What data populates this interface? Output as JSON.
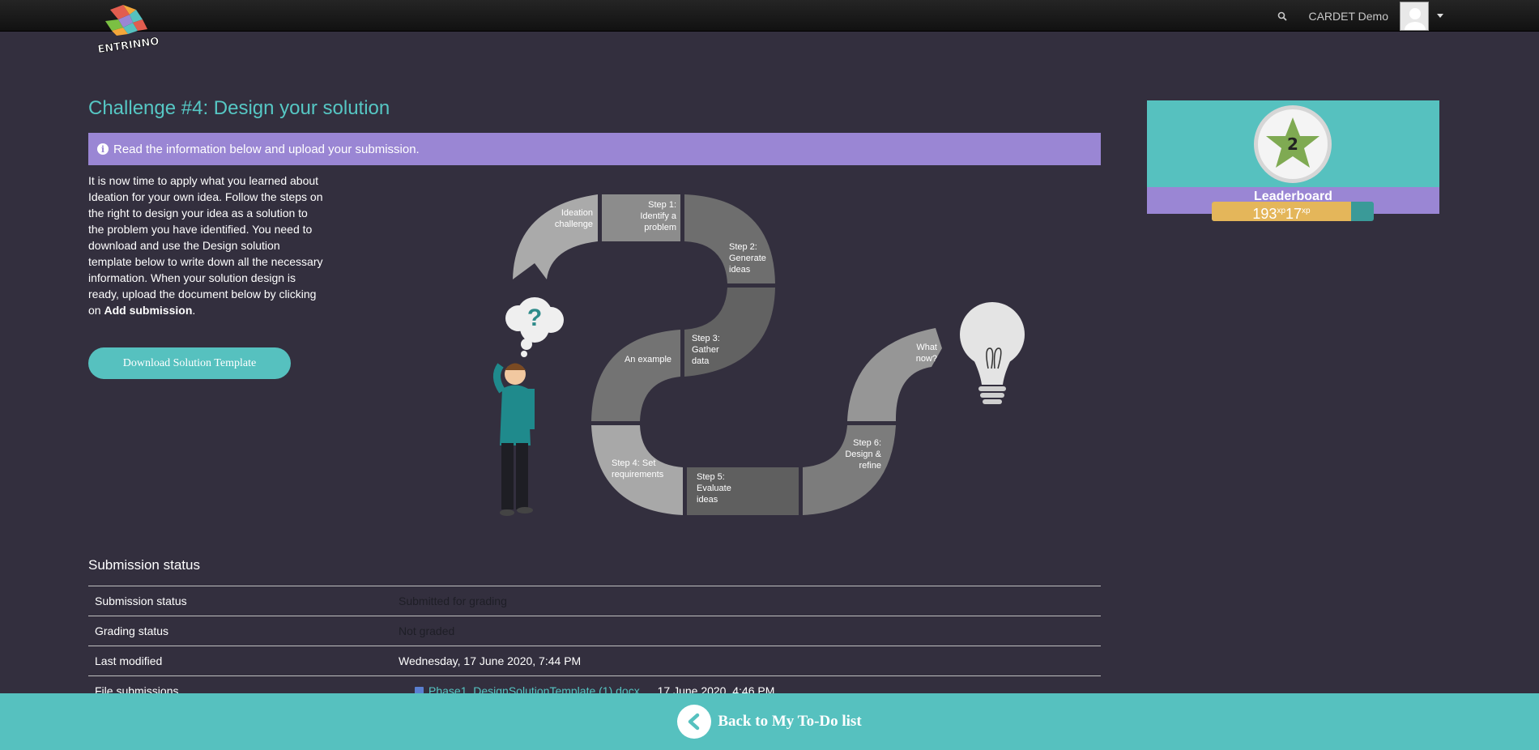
{
  "navbar": {
    "logo_text": "ENTRINNO",
    "user_name": "CARDET Demo"
  },
  "main": {
    "title": "Challenge #4: Design your solution",
    "info_text": "Read the information below and upload your submission.",
    "intro_text": "It is now time to apply what you learned about Ideation for your own idea. Follow the steps on the right to design your idea as a solution to the problem you have identified. You need to download and use the Design solution template below to write down all the necessary information. When your solution design is ready, upload the document below by clicking on ",
    "intro_bold": "Add submission",
    "intro_end": ".",
    "download_label": "Download Solution Template"
  },
  "diagram": {
    "ideation_challenge": [
      "Ideation",
      "challenge"
    ],
    "step1": [
      "Step 1:",
      "Identify a",
      "problem"
    ],
    "step2": [
      "Step 2:",
      "Generate",
      "ideas"
    ],
    "step3": [
      "Step 3:",
      "Gather",
      "data"
    ],
    "example": "An example",
    "step4": [
      "Step 4: Set",
      "requirements"
    ],
    "step5": [
      "Step 5:",
      "Evaluate",
      "ideas"
    ],
    "step6": [
      "Step 6:",
      "Design &",
      "refine"
    ],
    "what_now": [
      "What",
      "now?"
    ],
    "question_mark": "?"
  },
  "leaderboard": {
    "rank": "2",
    "label": "Leaderboard",
    "xp_value": "193",
    "xp_unit": "xp",
    "xp_gain": "17",
    "xp_progress": 0.86
  },
  "submission": {
    "title": "Submission status",
    "rows": [
      {
        "label": "Submission status",
        "value": "Submitted for grading"
      },
      {
        "label": "Grading status",
        "value": "Not graded"
      },
      {
        "label": "Last modified",
        "value": "Wednesday, 17 June 2020, 7:44 PM"
      }
    ],
    "file_row": {
      "label": "File submissions",
      "file_name": "Phase1_DesignSolutionTemplate (1).docx",
      "file_date": "17 June 2020, 4:46 PM"
    }
  },
  "footer": {
    "back_label": "Back to My To-Do list"
  }
}
